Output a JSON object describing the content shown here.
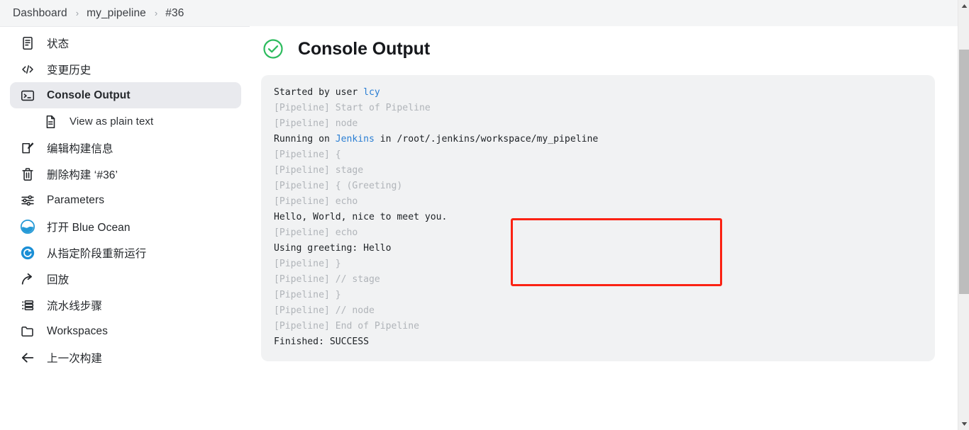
{
  "breadcrumb": {
    "items": [
      {
        "label": "Dashboard"
      },
      {
        "label": "my_pipeline"
      },
      {
        "label": "#36"
      }
    ],
    "separator": "›"
  },
  "sidebar": {
    "items": [
      {
        "label": "状态",
        "icon": "document-icon",
        "selected": false,
        "sub": false
      },
      {
        "label": "变更历史",
        "icon": "code-icon",
        "selected": false,
        "sub": false
      },
      {
        "label": "Console Output",
        "icon": "terminal-icon",
        "selected": true,
        "sub": false
      },
      {
        "label": "View as plain text",
        "icon": "file-text-icon",
        "selected": false,
        "sub": true
      },
      {
        "label": "编辑构建信息",
        "icon": "edit-icon",
        "selected": false,
        "sub": false
      },
      {
        "label": "删除构建 ‘#36’",
        "icon": "trash-icon",
        "selected": false,
        "sub": false
      },
      {
        "label": "Parameters",
        "icon": "sliders-icon",
        "selected": false,
        "sub": false
      },
      {
        "label": "打开 Blue Ocean",
        "icon": "blue-ocean-icon",
        "selected": false,
        "sub": false
      },
      {
        "label": "从指定阶段重新运行",
        "icon": "restart-icon",
        "selected": false,
        "sub": false
      },
      {
        "label": "回放",
        "icon": "replay-arrow-icon",
        "selected": false,
        "sub": false
      },
      {
        "label": "流水线步骤",
        "icon": "steps-list-icon",
        "selected": false,
        "sub": false
      },
      {
        "label": "Workspaces",
        "icon": "folder-icon",
        "selected": false,
        "sub": false
      },
      {
        "label": "上一次构建",
        "icon": "arrow-left-icon",
        "selected": false,
        "sub": false
      }
    ]
  },
  "main": {
    "title": "Console Output",
    "status_icon": "check-circle-icon",
    "status": "SUCCESS"
  },
  "console": {
    "lines": [
      {
        "segments": [
          {
            "text": "Started by user ",
            "style": "normal"
          },
          {
            "text": "lcy",
            "style": "link"
          }
        ]
      },
      {
        "segments": [
          {
            "text": "[Pipeline] Start of Pipeline",
            "style": "muted"
          }
        ]
      },
      {
        "segments": [
          {
            "text": "[Pipeline] node",
            "style": "muted"
          }
        ]
      },
      {
        "segments": [
          {
            "text": "Running on ",
            "style": "normal"
          },
          {
            "text": "Jenkins",
            "style": "link"
          },
          {
            "text": " in /root/.jenkins/workspace/my_pipeline",
            "style": "normal"
          }
        ]
      },
      {
        "segments": [
          {
            "text": "[Pipeline] {",
            "style": "muted"
          }
        ]
      },
      {
        "segments": [
          {
            "text": "[Pipeline] stage",
            "style": "muted"
          }
        ]
      },
      {
        "segments": [
          {
            "text": "[Pipeline] { (Greeting)",
            "style": "muted"
          }
        ]
      },
      {
        "segments": [
          {
            "text": "[Pipeline] echo",
            "style": "muted"
          }
        ]
      },
      {
        "segments": [
          {
            "text": "Hello, World, nice to meet you.",
            "style": "normal"
          }
        ]
      },
      {
        "segments": [
          {
            "text": "[Pipeline] echo",
            "style": "muted"
          }
        ]
      },
      {
        "segments": [
          {
            "text": "Using greeting: Hello",
            "style": "normal"
          }
        ]
      },
      {
        "segments": [
          {
            "text": "[Pipeline] }",
            "style": "muted"
          }
        ]
      },
      {
        "segments": [
          {
            "text": "[Pipeline] // stage",
            "style": "muted"
          }
        ]
      },
      {
        "segments": [
          {
            "text": "[Pipeline] }",
            "style": "muted"
          }
        ]
      },
      {
        "segments": [
          {
            "text": "[Pipeline] // node",
            "style": "muted"
          }
        ]
      },
      {
        "segments": [
          {
            "text": "[Pipeline] End of Pipeline",
            "style": "muted"
          }
        ]
      },
      {
        "segments": [
          {
            "text": "Finished: SUCCESS",
            "style": "normal"
          }
        ]
      }
    ]
  },
  "annotation": {
    "type": "red-rectangle",
    "color": "#fb2213",
    "covers_lines": [
      "[Pipeline] echo",
      "Hello, World, nice to meet you.",
      "[Pipeline] echo",
      "Using greeting: Hello"
    ]
  },
  "colors": {
    "accent_link": "#2a7ed3",
    "success_green": "#2cbb5d",
    "annotation_red": "#fb2213",
    "panel_bg": "#f1f2f3",
    "topbar_bg": "#f4f5f6",
    "selected_bg": "#e9eaee"
  },
  "scrollbar": {
    "up_arrow": "▲",
    "down_arrow": "▼"
  }
}
